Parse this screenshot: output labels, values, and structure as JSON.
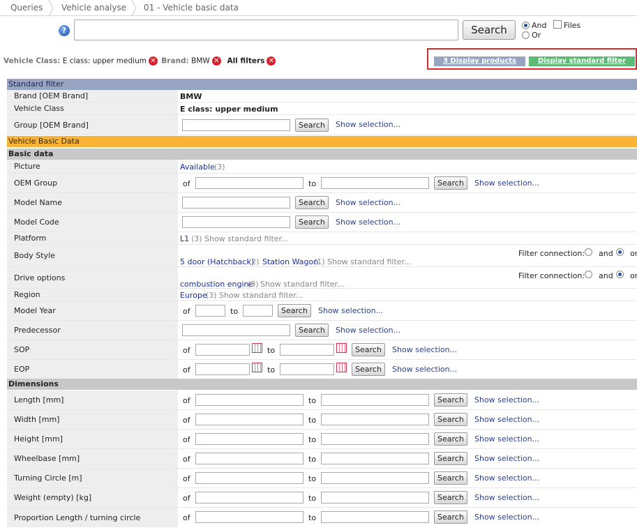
{
  "breadcrumb": [
    "Queries",
    "Vehicle analyse",
    "01 - Vehicle basic data"
  ],
  "search": {
    "value": "",
    "button": "Search",
    "and_label": "And",
    "or_label": "Or",
    "files_label": "Files",
    "mode": "And"
  },
  "active_filters": {
    "vehicle_class_label": "Vehicle Class:",
    "vehicle_class_value": "E class: upper medium",
    "brand_label": "Brand:",
    "brand_value": "BMW",
    "all_filters": "All filters"
  },
  "actions": {
    "display_products": "3 Display products",
    "display_standard_filter": "Display standard filter"
  },
  "colors": {
    "standard_filter_bar": "#97a4c2",
    "vehicle_basic_bar": "#f9b233",
    "subsection_bar": "#c8c8c8",
    "products_button": "#97a4c2",
    "standard_button": "#5dba74",
    "highlight_border": "#d62b2b"
  },
  "common": {
    "of": "of",
    "to": "to",
    "search": "Search",
    "show_selection": "Show selection...",
    "show_standard_filter": "Show standard filter...",
    "filter_connection": "Filter connection:",
    "and": "and",
    "or": "or"
  },
  "standard_filter": {
    "title": "Standard filter",
    "brand_label": "Brand [OEM Brand]",
    "brand_value": "BMW",
    "class_label": "Vehicle Class",
    "class_value": "E class: upper medium",
    "group_label": "Group [OEM Brand]"
  },
  "vehicle_basic": {
    "title": "Vehicle Basic Data",
    "basic_title": "Basic data",
    "picture": {
      "label": "Picture",
      "link": "Available",
      "count": "(3)"
    },
    "oem_group": "OEM Group",
    "model_name": "Model Name",
    "model_code": "Model Code",
    "platform": {
      "label": "Platform",
      "link": "L1",
      "count": "(3)"
    },
    "body_style": {
      "label": "Body Style",
      "opt1": "5 door (Hatchback)",
      "count1": "(2)",
      "opt2": "Station Wagon",
      "count2": "(1)"
    },
    "drive_options": {
      "label": "Drive options",
      "opt1": "combustion engine",
      "count1": "(3)"
    },
    "region": {
      "label": "Region",
      "link": "Europe",
      "count": "(3)"
    },
    "model_year": "Model Year",
    "predecessor": "Predecessor",
    "sop": "SOP",
    "eop": "EOP"
  },
  "dimensions": {
    "title": "Dimensions",
    "rows": [
      "Length [mm]",
      "Width [mm]",
      "Height [mm]",
      "Wheelbase [mm]",
      "Turning Circle [m]",
      "Weight (empty) [kg]",
      "Proportion Length / turning circle"
    ]
  }
}
